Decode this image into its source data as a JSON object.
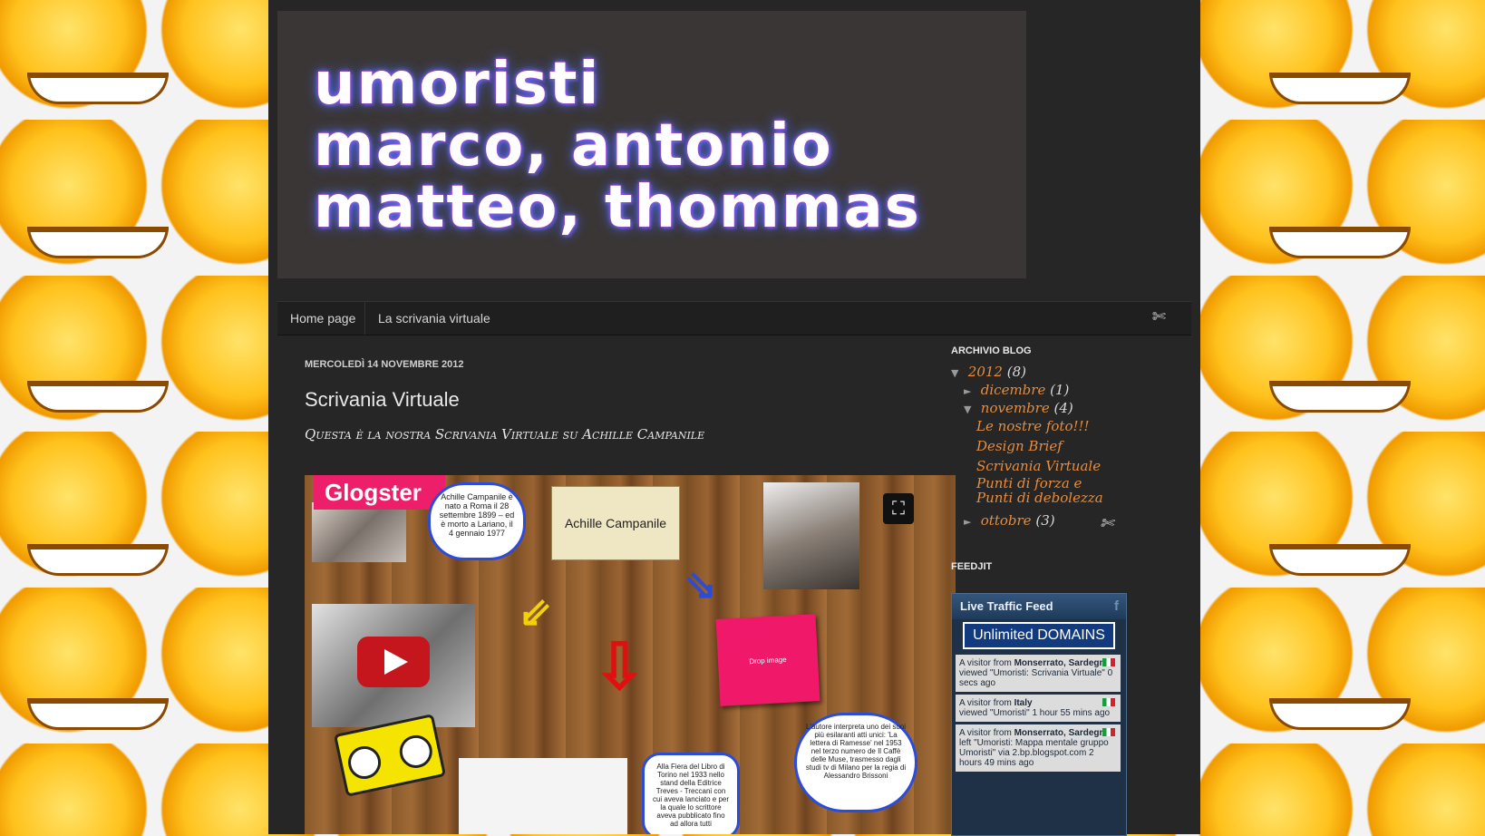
{
  "colors": {
    "accent": "#e78c3c",
    "page_bg": "#262626",
    "tabs_bg": "#1f1f1f",
    "feed_bg": "#1e3147",
    "glogster_pink": "#ed1f6b"
  },
  "header": {
    "title_lines": [
      "umoristi",
      "marco, antonio",
      "matteo, thommas"
    ]
  },
  "tabs": [
    {
      "label": "Home page"
    },
    {
      "label": "La scrivania virtuale"
    }
  ],
  "post": {
    "date": "MERCOLEDÌ 14 NOVEMBRE 2012",
    "title": "Scrivania Virtuale",
    "subtitle": "Questa è la nostra Scrivania Virtuale su Achille Campanile"
  },
  "glog": {
    "logo": "Glogster",
    "bubble1": "Achille Campanile è nato a Roma il 28 settembre 1899 – ed è morto a Lariano, il 4 gennaio 1977",
    "scroll_label": "Achille Campanile",
    "drop_label": "Drop image",
    "bubble2": "Alla Fiera del Libro di Torino nel 1933 nello stand della Editrice Treves - Treccani con cui aveva lanciato e per la quale lo scrittore aveva pubblicato fino ad allora tutti",
    "bubble3": "L'autore interpreta uno dei suoi più esilaranti atti unici: 'La lettera di Ramesse' nel 1953 nel terzo numero de Il Caffè delle Muse, trasmesso dagli studi tv di Milano per la regia di Alessandro Brissoni"
  },
  "sidebar": {
    "archive_heading": "ARCHIVIO BLOG",
    "year": {
      "label": "2012",
      "count": "(8)"
    },
    "months": [
      {
        "label": "dicembre",
        "count": "(1)"
      },
      {
        "label": "novembre",
        "count": "(4)"
      },
      {
        "label": "ottobre",
        "count": "(3)"
      }
    ],
    "posts": [
      "Le nostre foto!!!",
      "Design Brief",
      "Scrivania Virtuale",
      "Punti di forza e Punti di debolezza"
    ],
    "feedjit_heading": "FEEDJIT",
    "feed_title": "Live Traffic Feed",
    "ad": {
      "word1": "Unlimited",
      "word2": "DOMAINS"
    },
    "entries": [
      {
        "prefix": "A visitor from ",
        "place": "Monserrato, Sardegna",
        "action": "viewed ",
        "target": "\"Umoristi: Scrivania Virtuale\"",
        "time": " 0 secs ago"
      },
      {
        "prefix": "A visitor from ",
        "place": "Italy",
        "action": "viewed ",
        "target": "\"Umoristi\"",
        "time": " 1 hour 55 mins ago"
      },
      {
        "prefix": "A visitor from ",
        "place": "Monserrato, Sardegna",
        "action": "left ",
        "target": "\"Umoristi: Mappa mentale gruppo Umoristi\"",
        "via": " via 2.bp.blogspot.com",
        "time": " 2 hours 49 mins ago"
      }
    ]
  }
}
